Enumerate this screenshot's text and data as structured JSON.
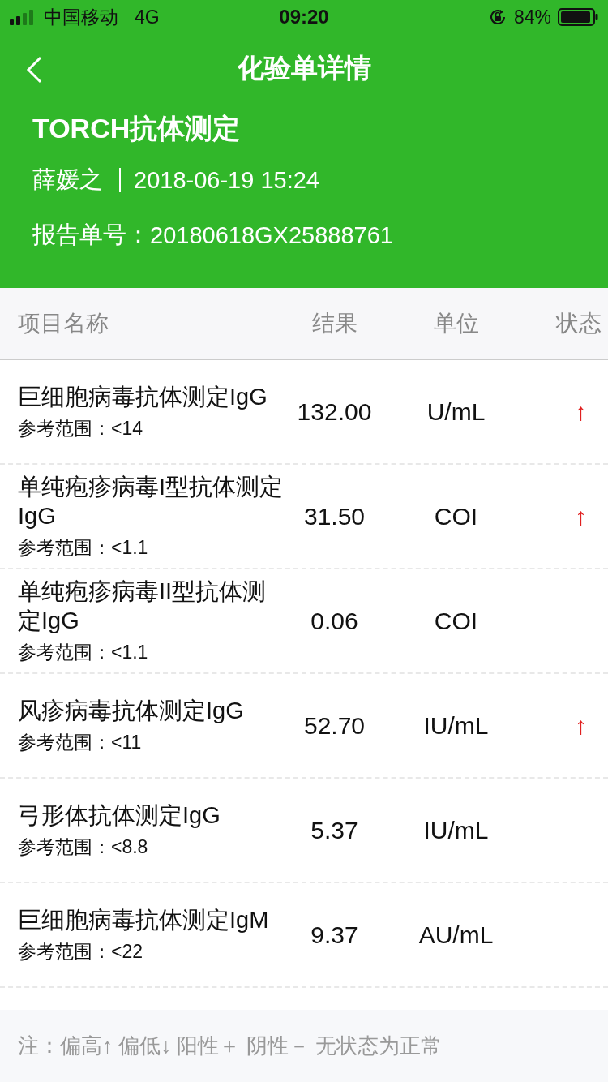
{
  "status_bar": {
    "carrier": "中国移动",
    "network": "4G",
    "time": "09:20",
    "battery": "84%"
  },
  "nav": {
    "title": "化验单详情"
  },
  "report": {
    "title": "TORCH抗体测定",
    "patient": "薛媛之",
    "datetime": "2018-06-19 15:24",
    "number_label": "报告单号：",
    "number": "20180618GX25888761"
  },
  "table": {
    "columns": [
      "项目名称",
      "结果",
      "单位",
      "状态"
    ],
    "rows": [
      {
        "name": "巨细胞病毒抗体测定IgG",
        "reference": "参考范围：<14",
        "result": "132.00",
        "unit": "U/mL",
        "status": "↑"
      },
      {
        "name": "单纯疱疹病毒I型抗体测定IgG",
        "reference": "参考范围：<1.1",
        "result": "31.50",
        "unit": "COI",
        "status": "↑"
      },
      {
        "name": "单纯疱疹病毒II型抗体测定IgG",
        "reference": "参考范围：<1.1",
        "result": "0.06",
        "unit": "COI"
      },
      {
        "name": "风疹病毒抗体测定IgG",
        "reference": "参考范围：<11",
        "result": "52.70",
        "unit": "IU/mL",
        "status": "↑"
      },
      {
        "name": "弓形体抗体测定IgG",
        "reference": "参考范围：<8.8",
        "result": "5.37",
        "unit": "IU/mL"
      },
      {
        "name": "巨细胞病毒抗体测定IgM",
        "reference": "参考范围：<22",
        "result": "9.37",
        "unit": "AU/mL"
      }
    ]
  },
  "footer_note": "注：偏高↑ 偏低↓ 阳性＋ 阴性－ 无状态为正常"
}
